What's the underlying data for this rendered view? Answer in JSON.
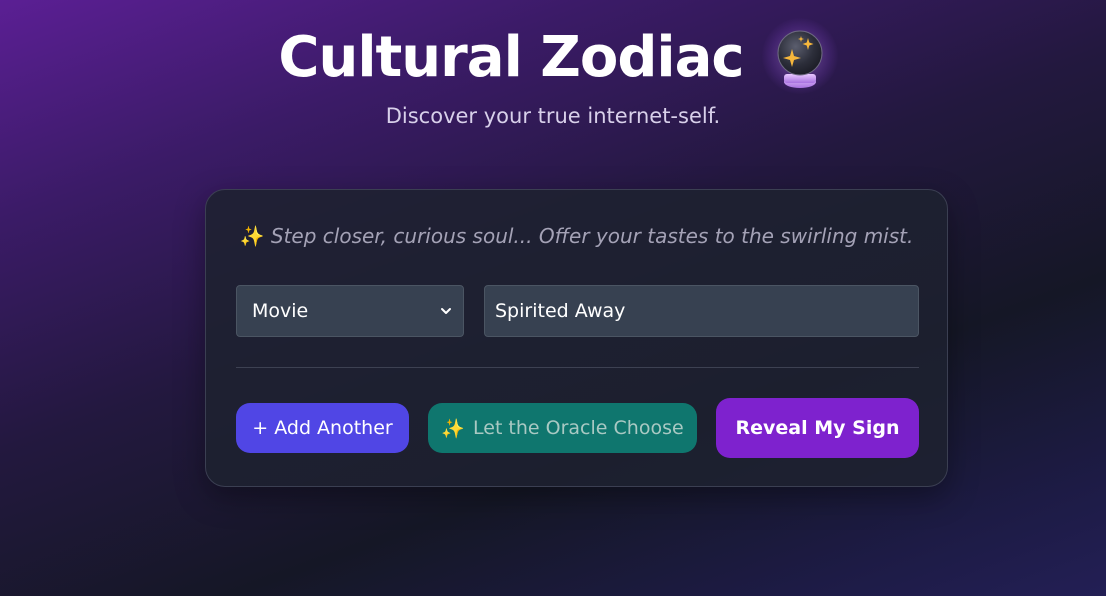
{
  "header": {
    "title": "Cultural Zodiac",
    "icon": "crystal-ball-icon",
    "subtitle": "Discover your true internet-self."
  },
  "card": {
    "prompt_icon": "✨",
    "prompt": "Step closer, curious soul... Offer your tastes to the swirling mist.",
    "category_select": {
      "value": "Movie"
    },
    "title_input": {
      "value": "Spirited Away"
    },
    "buttons": {
      "add_label": "+ Add Another",
      "oracle_icon": "✨",
      "oracle_label": "Let the Oracle Choose",
      "reveal_label": "Reveal My Sign"
    }
  },
  "colors": {
    "add_button": "#5046e5",
    "oracle_button": "#0f766e",
    "reveal_button": "#7e22ce",
    "card_bg": "#1e2130",
    "input_bg": "#374151"
  }
}
